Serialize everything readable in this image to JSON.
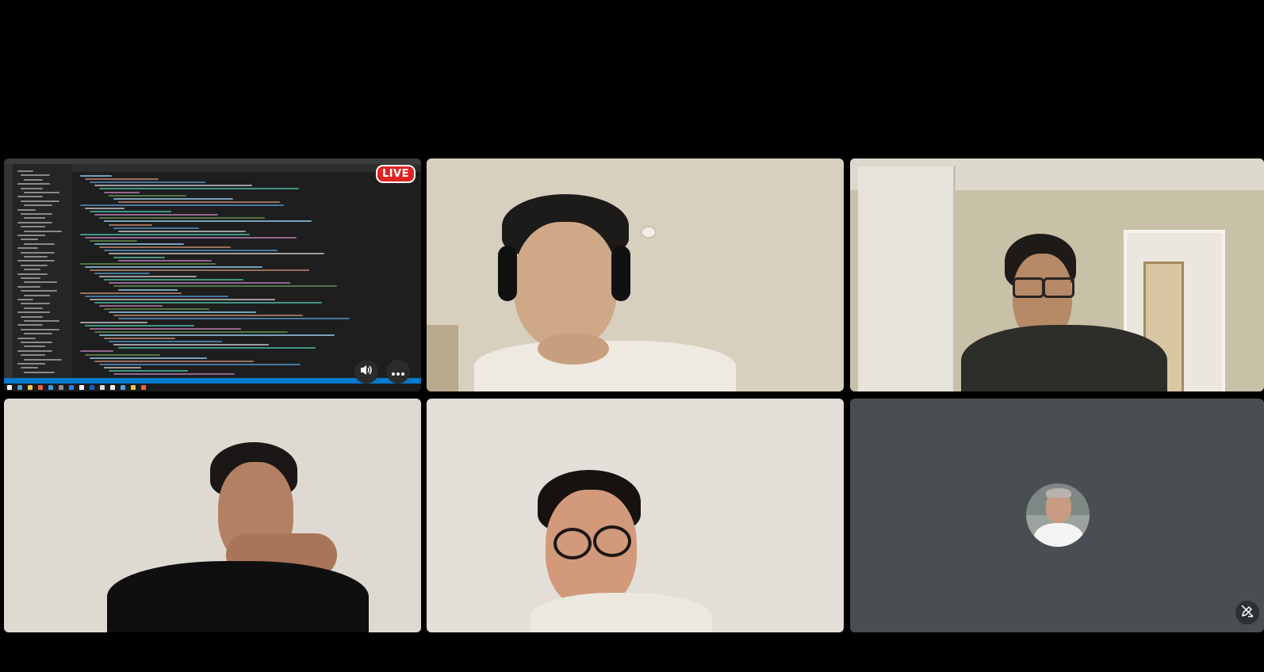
{
  "screen_share": {
    "live_badge": "LIVE",
    "controls": {
      "speaker_icon": "speaker-icon",
      "more_icon": "more-options-icon"
    }
  },
  "participants": [
    {
      "tile": "screen-share",
      "content": "screen"
    },
    {
      "tile": "participant-2",
      "content": "video"
    },
    {
      "tile": "participant-3",
      "content": "video"
    },
    {
      "tile": "participant-4",
      "content": "video"
    },
    {
      "tile": "participant-5",
      "content": "video"
    },
    {
      "tile": "participant-6",
      "content": "avatar"
    }
  ],
  "camera_off_icon": "camera-off-icon",
  "colors": {
    "background": "#000000",
    "live_red": "#e02424",
    "empty_tile": "#4a4d52",
    "vscode_status": "#007acc"
  }
}
